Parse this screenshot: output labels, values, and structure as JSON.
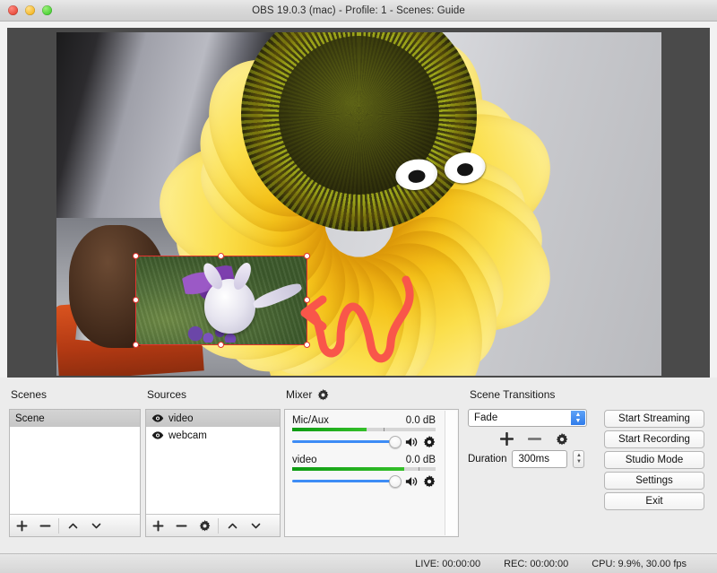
{
  "window": {
    "title": "OBS 19.0.3 (mac) - Profile: 1 - Scenes: Guide",
    "traffic_lights": [
      {
        "name": "close",
        "color": "#e74c3c"
      },
      {
        "name": "minimize",
        "color": "#f5b829"
      },
      {
        "name": "zoom",
        "color": "#4cd137"
      }
    ]
  },
  "preview": {
    "selection_color": "#e3342f",
    "annotation_color": "#f9564a",
    "canvas_background": "#4a4a4a"
  },
  "scenes": {
    "title": "Scenes",
    "items": [
      {
        "label": "Scene",
        "selected": true
      }
    ],
    "toolbar": {
      "add": "+",
      "remove": "−",
      "move_up": "add-icon-up",
      "move_down": "add-icon-down"
    }
  },
  "sources": {
    "title": "Sources",
    "items": [
      {
        "label": "video",
        "visible": true,
        "selected": true
      },
      {
        "label": "webcam",
        "visible": true,
        "selected": false
      }
    ],
    "toolbar": {
      "add": "+",
      "remove": "−",
      "properties": "gear-icon",
      "move_up": "chevron-up-icon",
      "move_down": "chevron-down-icon"
    }
  },
  "mixer": {
    "title": "Mixer",
    "settings_icon": "gear-icon",
    "channels": [
      {
        "name": "Mic/Aux",
        "level": "0.0 dB",
        "meter_percent": 52,
        "meter_tick_percent": 64,
        "volume_percent": 100,
        "muted": false
      },
      {
        "name": "video",
        "level": "0.0 dB",
        "meter_percent": 78,
        "meter_tick_percent": 88,
        "volume_percent": 100,
        "muted": false
      }
    ]
  },
  "scene_transitions": {
    "title": "Scene Transitions",
    "selected_transition": "Fade",
    "options": [
      "Fade"
    ],
    "add_label": "+",
    "remove_label": "−",
    "properties_label": "gear-icon",
    "duration_label": "Duration",
    "duration_value": "300ms"
  },
  "controls": {
    "buttons": [
      {
        "label": "Start Streaming"
      },
      {
        "label": "Start Recording"
      },
      {
        "label": "Studio Mode"
      },
      {
        "label": "Settings"
      },
      {
        "label": "Exit"
      }
    ]
  },
  "statusbar": {
    "live": "LIVE: 00:00:00",
    "rec": "REC: 00:00:00",
    "cpu": "CPU: 9.9%, 30.00 fps"
  }
}
